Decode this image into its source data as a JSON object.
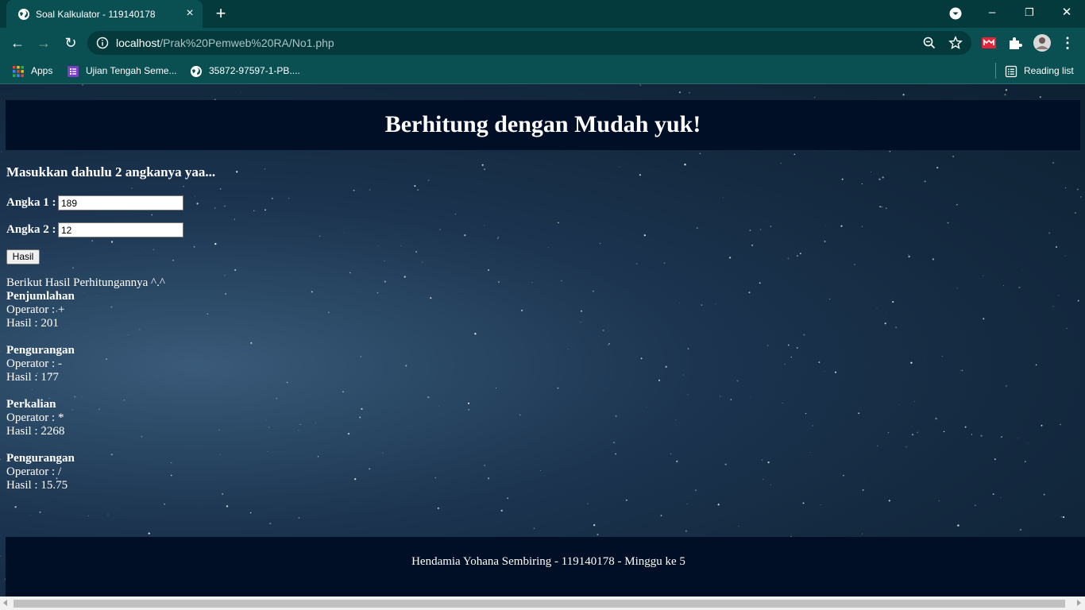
{
  "browser": {
    "tab": {
      "title": "Soal Kalkulator - 119140178",
      "close_glyph": "×"
    },
    "new_tab_glyph": "+",
    "window_controls": {
      "minimize": "–",
      "restore": "❐",
      "close": "✕"
    },
    "nav": {
      "back": "←",
      "forward": "→",
      "reload": "↻"
    },
    "url_host": "localhost",
    "url_path": "/Prak%20Pemweb%20RA/No1.php",
    "bookmarks": [
      {
        "label": "Apps",
        "icon": "apps-grid-icon"
      },
      {
        "label": "Ujian Tengah Seme...",
        "icon": "forms-icon"
      },
      {
        "label": "35872-97597-1-PB....",
        "icon": "globe-icon"
      }
    ],
    "reading_list_label": "Reading list",
    "accent": "#0a4f52",
    "tabbar_color": "#053a3c"
  },
  "page": {
    "header_title": "Berhitung dengan Mudah yuk!",
    "prompt": "Masukkan dahulu 2 angkanya yaa...",
    "angka1_label": "Angka 1 :",
    "angka1_value": "189",
    "angka2_label": "Angka 2 :",
    "angka2_value": "12",
    "submit_label": "Hasil",
    "results_intro": "Berikut Hasil Perhitungannya ^.^",
    "operations": [
      {
        "name": "Penjumlahan",
        "operator": "Operator : +",
        "result": "Hasil : 201"
      },
      {
        "name": "Pengurangan",
        "operator": "Operator : -",
        "result": "Hasil : 177"
      },
      {
        "name": "Perkalian",
        "operator": "Operator : *",
        "result": "Hasil : 2268"
      },
      {
        "name": "Pengurangan",
        "operator": "Operator : /",
        "result": "Hasil : 15.75"
      }
    ],
    "footer_text": "Hendamia Yohana Sembiring - 119140178 - Minggu ke 5",
    "header_bg": "#000f25"
  }
}
